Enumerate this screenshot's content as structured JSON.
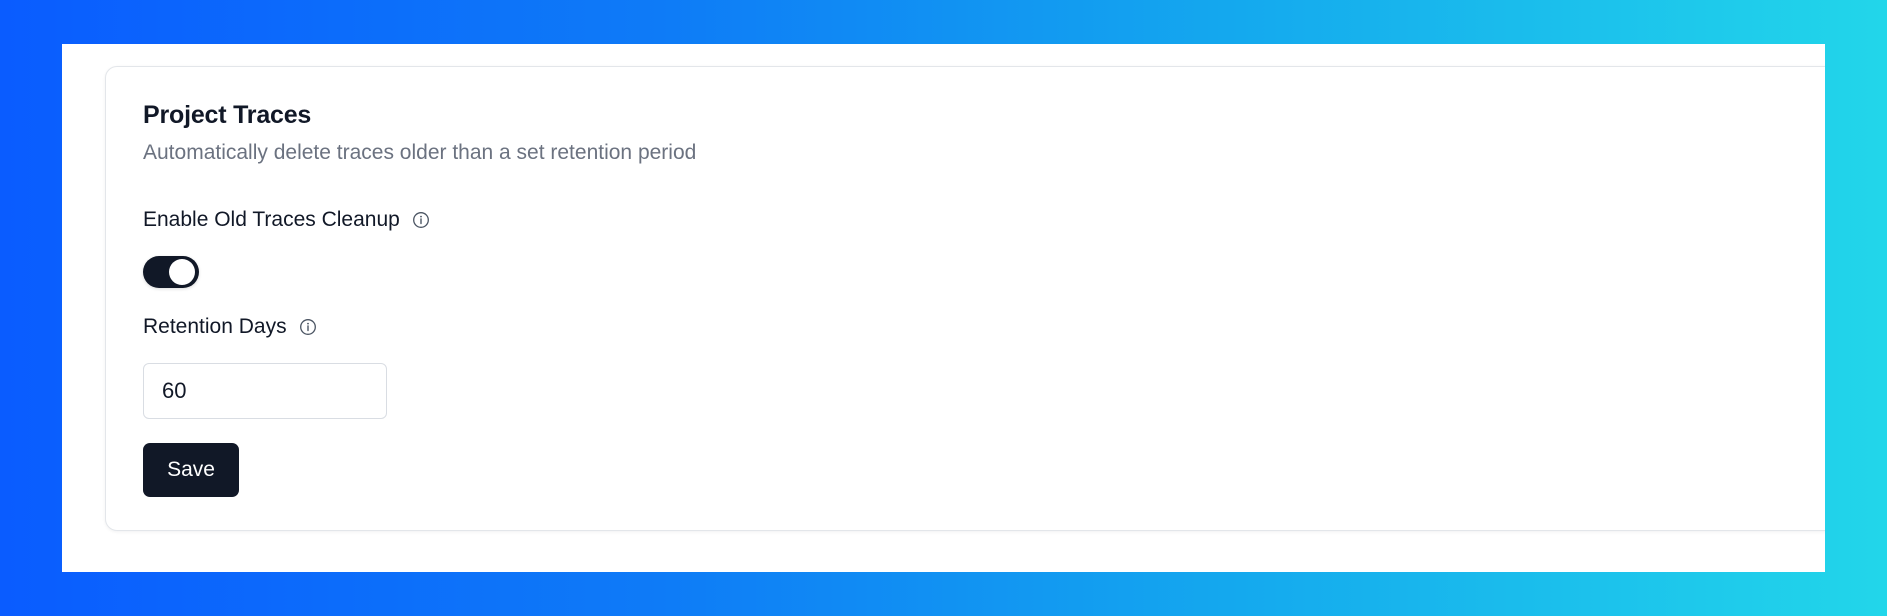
{
  "card": {
    "title": "Project Traces",
    "description": "Automatically delete traces older than a set retention period"
  },
  "cleanup": {
    "label": "Enable Old Traces Cleanup",
    "info_icon": "info-icon",
    "enabled": true
  },
  "retention": {
    "label": "Retention Days",
    "info_icon": "info-icon",
    "value": "60"
  },
  "actions": {
    "save_label": "Save"
  },
  "colors": {
    "primary": "#111827",
    "muted_text": "#6b7280",
    "gradient_start": "#0a5cff",
    "gradient_end": "#22d6ea"
  }
}
